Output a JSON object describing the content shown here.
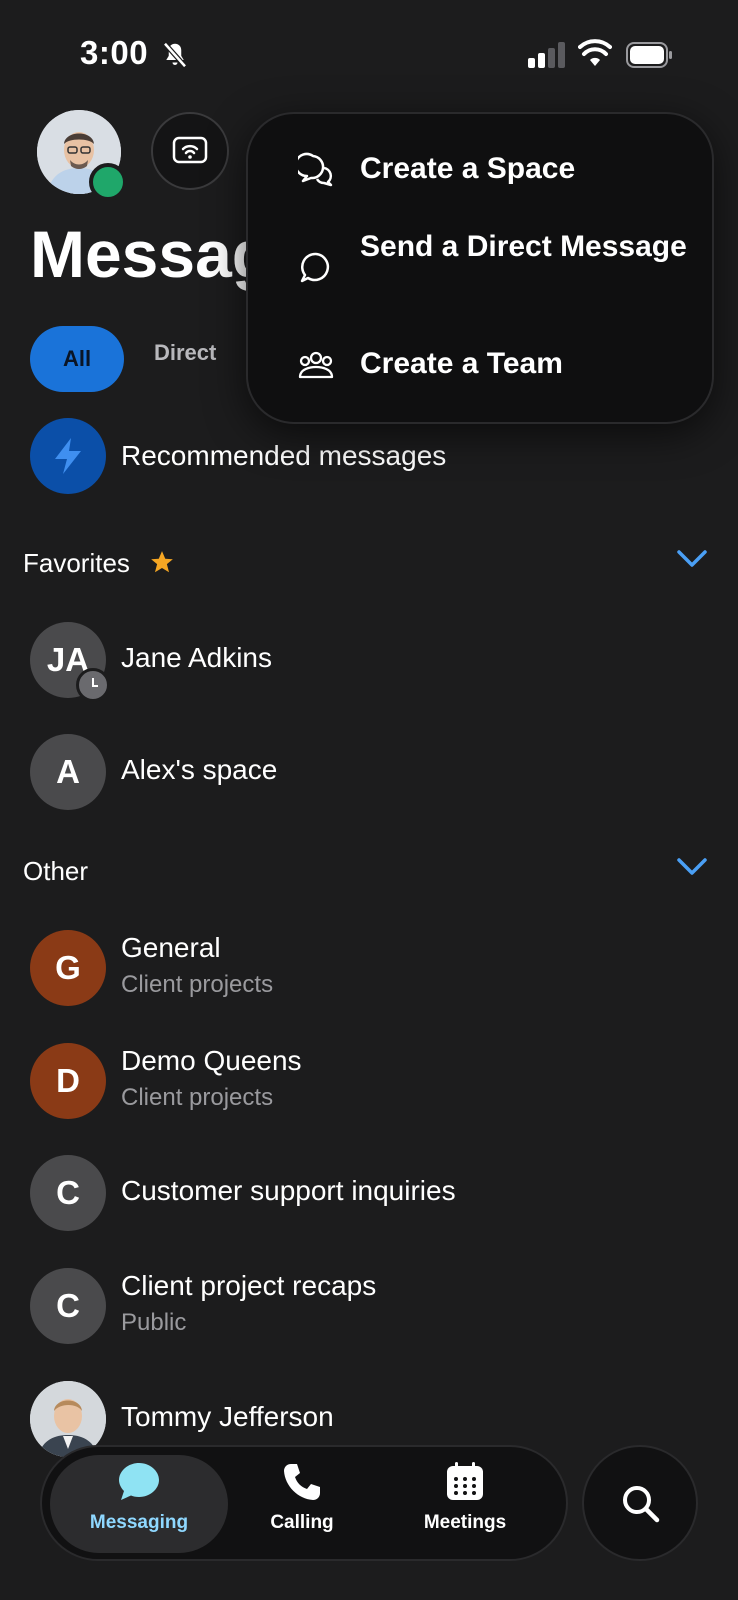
{
  "status_bar": {
    "time": "3:00"
  },
  "header": {
    "title": "Messag"
  },
  "filters": {
    "all": "All",
    "direct": "Direct"
  },
  "menu": {
    "items": [
      {
        "label": "Create a Space",
        "icon": "chat-bubbles-icon"
      },
      {
        "label": "Send a Direct Message",
        "icon": "chat-bubble-icon"
      },
      {
        "label": "Create a Team",
        "icon": "team-icon"
      }
    ]
  },
  "recommended": {
    "label": "Recommended messages"
  },
  "favorites": {
    "title": "Favorites",
    "items": [
      {
        "initials": "JA",
        "name": "Jane Adkins"
      },
      {
        "initials": "A",
        "name": "Alex's space"
      }
    ]
  },
  "other": {
    "title": "Other",
    "items": [
      {
        "initials": "G",
        "name": "General",
        "sub": "Client projects",
        "color": "#8a3a16"
      },
      {
        "initials": "D",
        "name": "Demo Queens",
        "sub": "Client projects",
        "color": "#8a3a16"
      },
      {
        "initials": "C",
        "name": "Customer support inquiries",
        "color": "#4a4a4c"
      },
      {
        "initials": "C",
        "name": "Client project recaps",
        "sub": "Public",
        "color": "#4a4a4c"
      },
      {
        "name": "Tommy Jefferson"
      }
    ]
  },
  "nav": {
    "messaging": "Messaging",
    "calling": "Calling",
    "meetings": "Meetings"
  },
  "colors": {
    "accent": "#1a73d9",
    "chevron": "#4a9ff5",
    "star": "#f5a623",
    "presence": "#1fa76a"
  }
}
